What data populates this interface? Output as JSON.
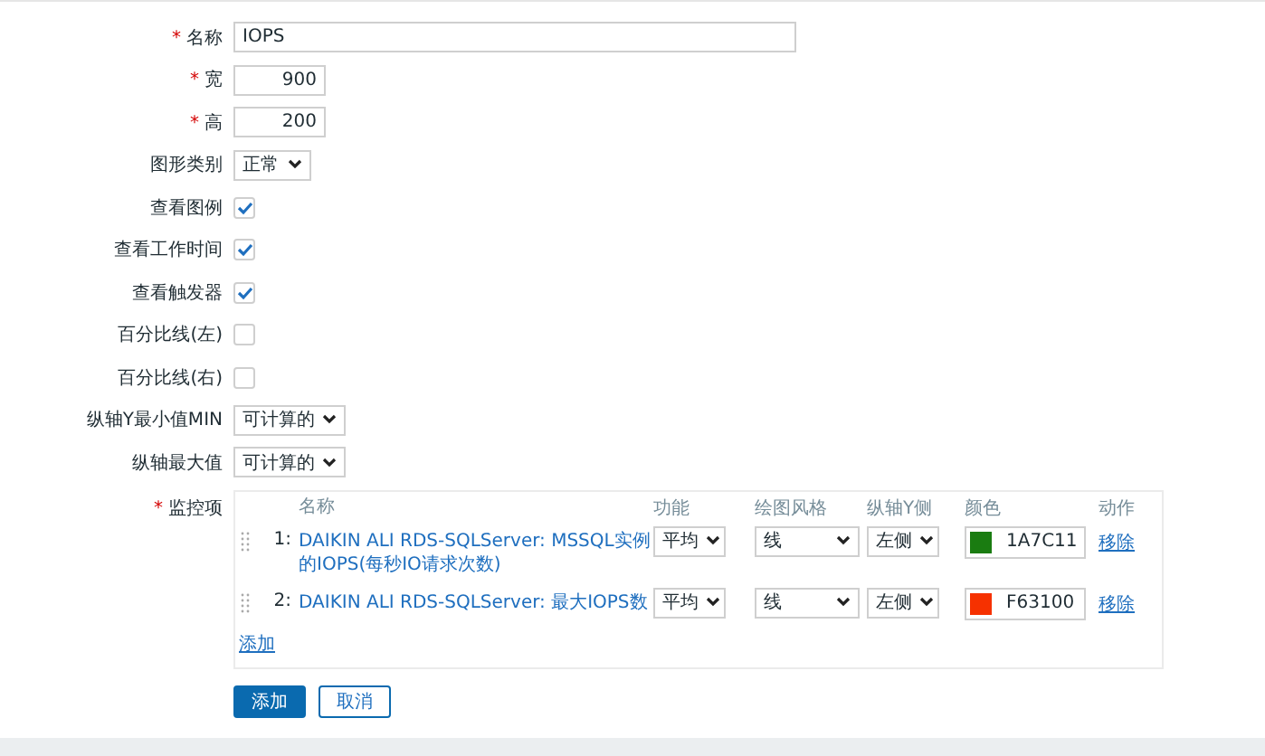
{
  "fields": [
    {
      "kind": "text",
      "label": "名称",
      "required_mark": "*",
      "value": "IOPS"
    },
    {
      "kind": "number",
      "label": "宽",
      "required_mark": "*",
      "value": "900"
    },
    {
      "kind": "number",
      "label": "高",
      "required_mark": "*",
      "value": "200"
    },
    {
      "kind": "select",
      "label": "图形类别",
      "value": "正常"
    },
    {
      "kind": "checkbox",
      "label": "查看图例",
      "checked": true
    },
    {
      "kind": "checkbox",
      "label": "查看工作时间",
      "checked": true
    },
    {
      "kind": "checkbox",
      "label": "查看触发器",
      "checked": true
    },
    {
      "kind": "checkbox",
      "label": "百分比线(左)",
      "checked": false
    },
    {
      "kind": "checkbox",
      "label": "百分比线(右)",
      "checked": false
    },
    {
      "kind": "select",
      "label": "纵轴Y最小值MIN",
      "value": "可计算的"
    },
    {
      "kind": "select",
      "label": "纵轴最大值",
      "value": "可计算的"
    }
  ],
  "items": {
    "label": "监控项",
    "required_mark": "*",
    "columns": [
      "名称",
      "功能",
      "绘图风格",
      "纵轴Y侧",
      "颜色",
      "动作"
    ],
    "rows": [
      {
        "index": "1:",
        "name": "DAIKIN ALI RDS-SQLServer: MSSQL实例的IOPS(每秒IO请求次数)",
        "function": "平均",
        "style": "线",
        "axis": "左侧",
        "color_text": "1A7C11",
        "color": "#1a7c11",
        "action": "移除"
      },
      {
        "index": "2:",
        "name": "DAIKIN ALI RDS-SQLServer: 最大IOPS数",
        "function": "平均",
        "style": "线",
        "axis": "左侧",
        "color_text": "F63100",
        "color": "#f63100",
        "action": "移除"
      }
    ],
    "add_link": "添加"
  },
  "buttons": [
    {
      "label": "添加",
      "kind": "primary"
    },
    {
      "label": "取消",
      "kind": "secondary"
    }
  ]
}
